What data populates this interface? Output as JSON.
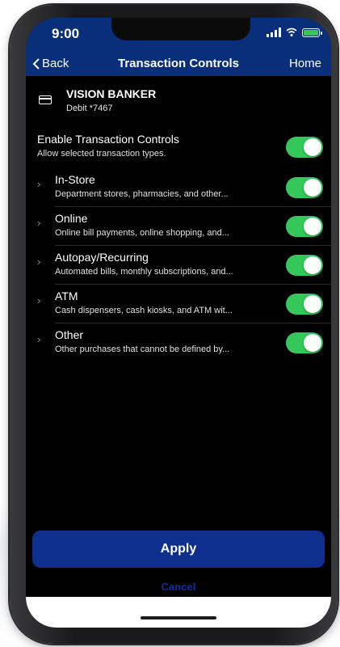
{
  "status_bar": {
    "time": "9:00",
    "icons": [
      "signal-icon",
      "wifi-icon",
      "battery-icon"
    ]
  },
  "nav": {
    "back_label": "Back",
    "title": "Transaction Controls",
    "home_label": "Home"
  },
  "card": {
    "name": "VISION BANKER",
    "number": "Debit *7467",
    "icon": "credit-card-icon"
  },
  "master": {
    "title": "Enable Transaction Controls",
    "subtitle": "Allow selected transaction types.",
    "enabled": true
  },
  "categories": [
    {
      "title": "In-Store",
      "subtitle": "Department stores, pharmacies, and other...",
      "enabled": true
    },
    {
      "title": "Online",
      "subtitle": "Online bill payments, online shopping, and...",
      "enabled": true
    },
    {
      "title": "Autopay/Recurring",
      "subtitle": "Automated bills, monthly subscriptions, and...",
      "enabled": true
    },
    {
      "title": "ATM",
      "subtitle": "Cash dispensers, cash kiosks, and ATM wit...",
      "enabled": true
    },
    {
      "title": "Other",
      "subtitle": "Other purchases that cannot be defined by...",
      "enabled": true
    }
  ],
  "actions": {
    "apply_label": "Apply",
    "cancel_label": "Cancel"
  },
  "colors": {
    "header_blue": "#0a2f7a",
    "toggle_green": "#34c759",
    "apply_blue": "#0f2f8f",
    "background": "#000000"
  }
}
